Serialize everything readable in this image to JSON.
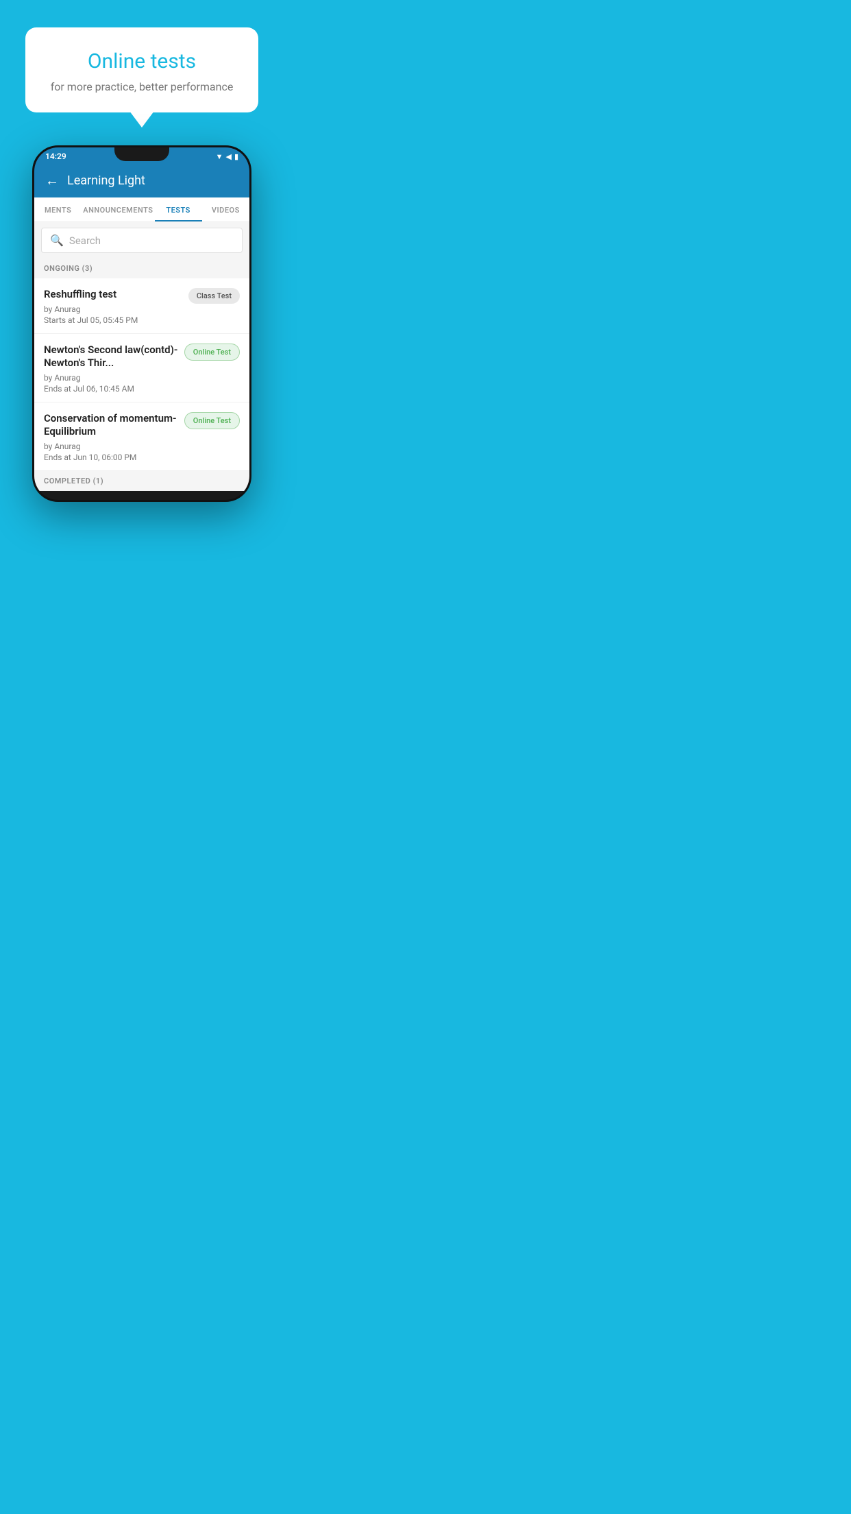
{
  "background": {
    "color": "#18b8e0"
  },
  "speech_bubble": {
    "title": "Online tests",
    "subtitle": "for more practice, better performance"
  },
  "phone": {
    "status_bar": {
      "time": "14:29",
      "icons": [
        "wifi",
        "signal",
        "battery"
      ]
    },
    "app_header": {
      "title": "Learning Light",
      "back_label": "←"
    },
    "tabs": [
      {
        "label": "MENTS",
        "active": false
      },
      {
        "label": "ANNOUNCEMENTS",
        "active": false
      },
      {
        "label": "TESTS",
        "active": true
      },
      {
        "label": "VIDEOS",
        "active": false
      }
    ],
    "search": {
      "placeholder": "Search",
      "icon": "🔍"
    },
    "ongoing_section": {
      "label": "ONGOING (3)",
      "tests": [
        {
          "name": "Reshuffling test",
          "by": "by Anurag",
          "time": "Starts at  Jul 05, 05:45 PM",
          "badge": "Class Test",
          "badge_type": "class"
        },
        {
          "name": "Newton's Second law(contd)-Newton's Thir...",
          "by": "by Anurag",
          "time": "Ends at  Jul 06, 10:45 AM",
          "badge": "Online Test",
          "badge_type": "online"
        },
        {
          "name": "Conservation of momentum-Equilibrium",
          "by": "by Anurag",
          "time": "Ends at  Jun 10, 06:00 PM",
          "badge": "Online Test",
          "badge_type": "online"
        }
      ]
    },
    "completed_section": {
      "label": "COMPLETED (1)"
    }
  }
}
